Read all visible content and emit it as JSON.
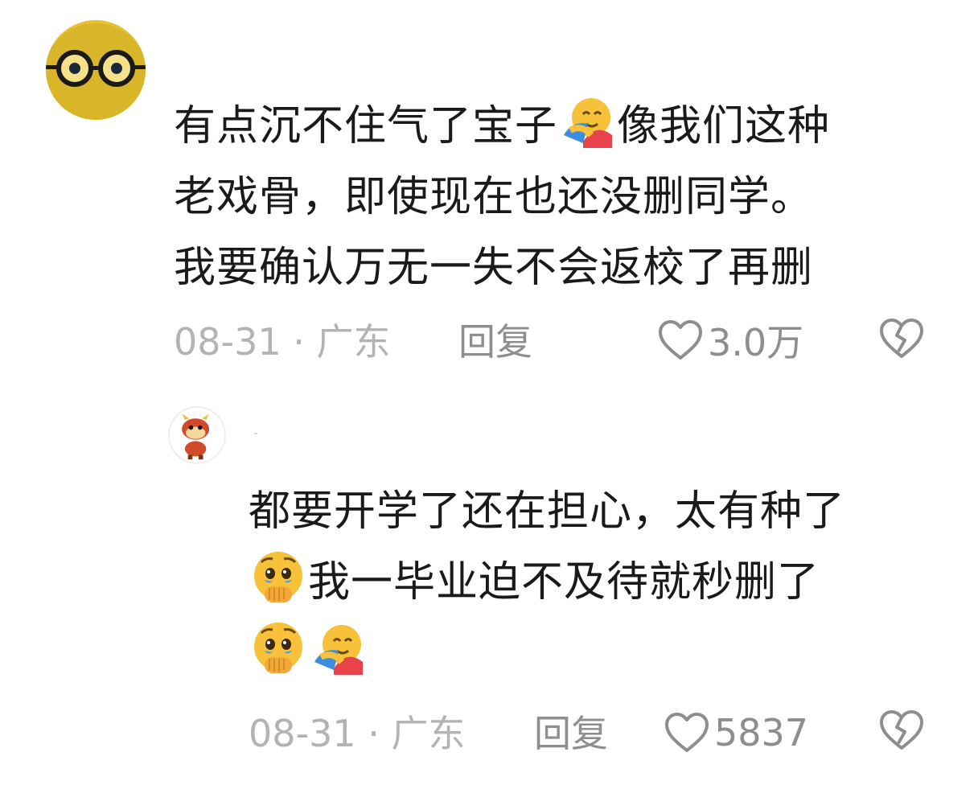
{
  "comments": [
    {
      "lines": [
        {
          "a": "有点沉不住气了宝子",
          "emoji": "hugging-face-emoji",
          "b": "像我们这种"
        },
        {
          "a": "老戏骨，即使现在也还没删同学。"
        },
        {
          "a": "我要确认万无一失不会返校了再删"
        }
      ],
      "date_location": "08-31 · 广东",
      "reply_label": "回复",
      "like_count": "3.0万"
    },
    {
      "lines": [
        {
          "a": "都要开学了还在担心，太有种了"
        },
        {
          "emoji": "holding-back-tears-emoji",
          "a": "我一毕业迫不及待就秒删了"
        },
        {
          "emoji": "holding-back-tears-emoji",
          "emoji2": "hugging-face-emoji"
        }
      ],
      "date_location": "08-31 · 广东",
      "reply_label": "回复",
      "like_count": "5837"
    }
  ],
  "colors": {
    "text": "#1a1a1a",
    "meta": "#b3b3b3",
    "action": "#8e8e8e"
  }
}
